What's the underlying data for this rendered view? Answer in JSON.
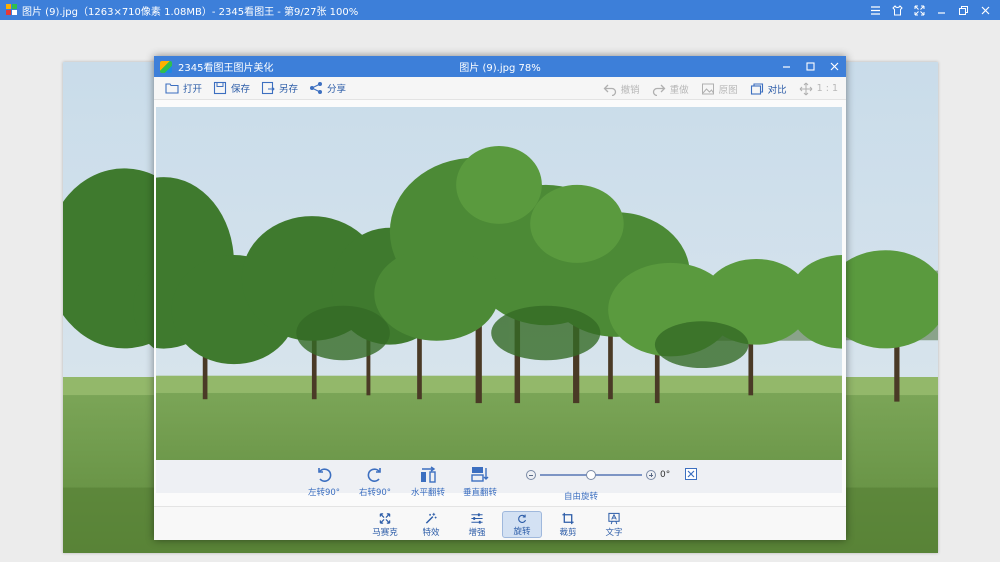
{
  "outer_window": {
    "title": "图片 (9).jpg（1263×710像素 1.08MB）- 2345看图王 - 第9/27张 100%",
    "controls": [
      "menu-icon",
      "skin-icon",
      "fullscreen-icon",
      "minimize-icon",
      "restore-icon",
      "close-icon"
    ]
  },
  "editor": {
    "app_name": "2345看图王图片美化",
    "file_title": "图片 (9).jpg   78%",
    "toolbar": {
      "open": "打开",
      "save": "保存",
      "save_as": "另存",
      "share": "分享",
      "undo": "撤销",
      "redo": "重做",
      "original": "原图",
      "compare": "对比",
      "one_to_one": "1 : 1"
    },
    "rotate_panel": {
      "rotate_left": "左转90°",
      "rotate_right": "右转90°",
      "flip_horizontal": "水平翻转",
      "flip_vertical": "垂直翻转",
      "free_rotate": "自由旋转",
      "angle": "0°",
      "angle_level": 0.5
    },
    "tabs": [
      {
        "label": "马赛克",
        "icon": "mosaic-icon"
      },
      {
        "label": "特效",
        "icon": "magic-wand-icon"
      },
      {
        "label": "增强",
        "icon": "sliders-icon"
      },
      {
        "label": "旋转",
        "icon": "rotate-icon",
        "active": true
      },
      {
        "label": "裁剪",
        "icon": "crop-icon"
      },
      {
        "label": "文字",
        "icon": "text-icon"
      }
    ]
  },
  "colors": {
    "title_bar": "#3d7fd9",
    "accent_text": "#2d5da8",
    "active_tab": "#d3e1f3"
  }
}
